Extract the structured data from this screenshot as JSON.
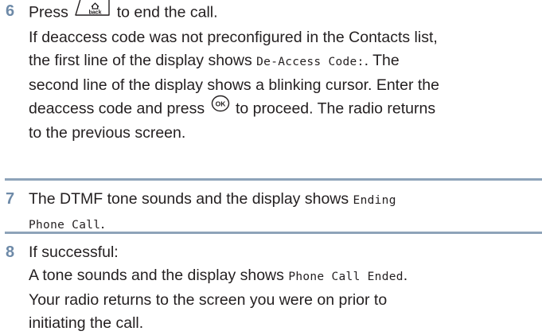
{
  "steps": [
    {
      "number": "6",
      "line1_pre": "Press",
      "line1_key_icon": "back-home-key-icon",
      "line1_post": "to end the call.",
      "para_a": "If deaccess code was not preconfigured in the Contacts list,",
      "para_b_pre": "the first line of the display shows",
      "para_b_code": "De-Access Code:",
      "para_b_post": ". The",
      "para_c": "second line of the display shows a blinking cursor. Enter the",
      "para_d_pre": "deaccess code and press",
      "para_d_key_icon": "ok-key-icon",
      "para_d_post": "to proceed. The radio returns",
      "para_e": "to the previous screen."
    },
    {
      "number": "7",
      "line1_pre": "The DTMF tone sounds and the display shows",
      "line1_code": "Ending",
      "line2_code": "Phone Call",
      "line2_post": "."
    },
    {
      "number": "8",
      "line1": "If successful:",
      "line2_pre": "A tone sounds and the display shows",
      "line2_code": "Phone Call Ended",
      "line2_post": ".",
      "line3": "Your radio returns to the screen you were on prior to",
      "line4": "initiating the call."
    }
  ],
  "icon_labels": {
    "back_key_text": "back"
  },
  "colors": {
    "step_number": "#6e8aa8",
    "divider": "#8ea3b9",
    "text": "#231f20"
  }
}
